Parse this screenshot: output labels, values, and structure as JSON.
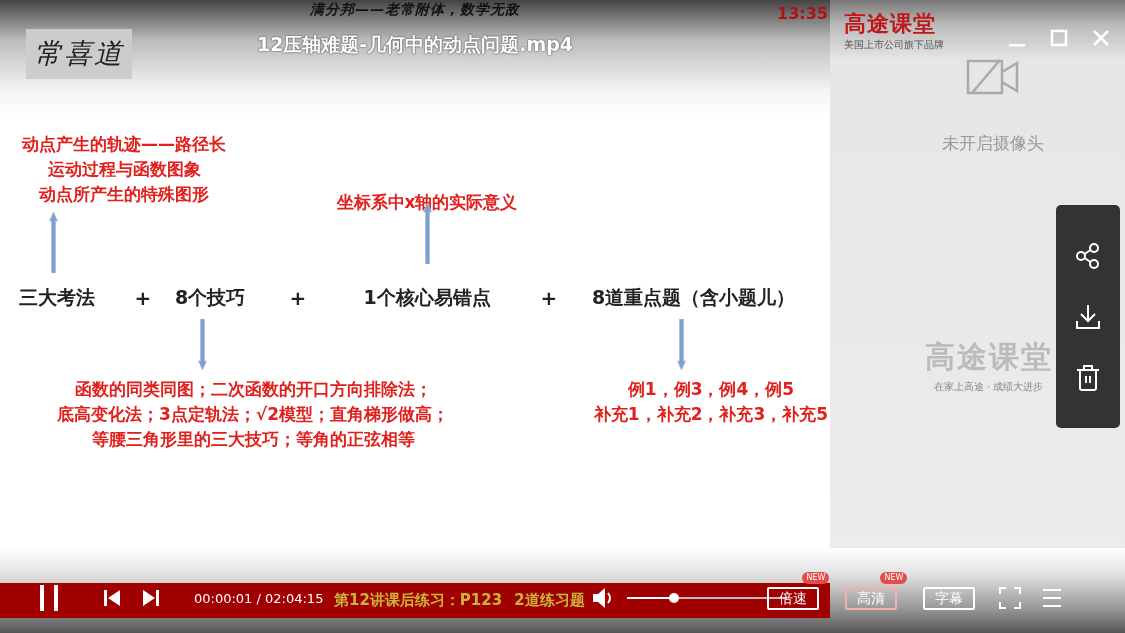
{
  "player": {
    "title": "12压轴难题-几何中的动点问题.mp4"
  },
  "slide": {
    "header": "满分邦——老常附体，数学无敌",
    "clock": "13:35",
    "signature": "常喜道",
    "topics": [
      {
        "kind": "topic",
        "label": "三大考法",
        "above": [
          "动点产生的轨迹——路径长",
          "运动过程与函数图象",
          "动点所产生的特殊图形"
        ]
      },
      {
        "kind": "plus",
        "label": "+"
      },
      {
        "kind": "topic",
        "label": "8个技巧",
        "below": [
          "函数的同类同图；二次函数的开口方向排除法；",
          "底高变化法；3点定轨法；√2模型；直角梯形做高；",
          "等腰三角形里的三大技巧；等角的正弦相等"
        ]
      },
      {
        "kind": "plus",
        "label": "+"
      },
      {
        "kind": "topic",
        "label": "1个核心易错点",
        "above": [
          "坐标系中x轴的实际意义"
        ]
      },
      {
        "kind": "plus",
        "label": "+"
      },
      {
        "kind": "topic",
        "label": "8道重点题（含小题儿）",
        "below": [
          "例1，例3，例4，例5",
          "补充1，补充2，补充3，补充5"
        ]
      }
    ]
  },
  "subtitle": [
    "第12讲课后练习：P123",
    "2道练习题"
  ],
  "controls": {
    "playing": true,
    "time": "00:00:01 / 02:04:15",
    "volume": {
      "level": 0.29
    },
    "buttons": [
      {
        "label": "倍速",
        "badge": "NEW",
        "selected": false
      },
      {
        "label": "高清",
        "badge": "NEW",
        "selected": true
      },
      {
        "label": "字幕",
        "selected": false
      }
    ]
  },
  "side_panel": {
    "brand": "高途课堂",
    "tagline": "美国上市公司旗下品牌",
    "camera_status": "未开启摄像头",
    "logo_brand": "高途课堂",
    "logo_tagline": "在家上高途 · 成绩大进步"
  }
}
